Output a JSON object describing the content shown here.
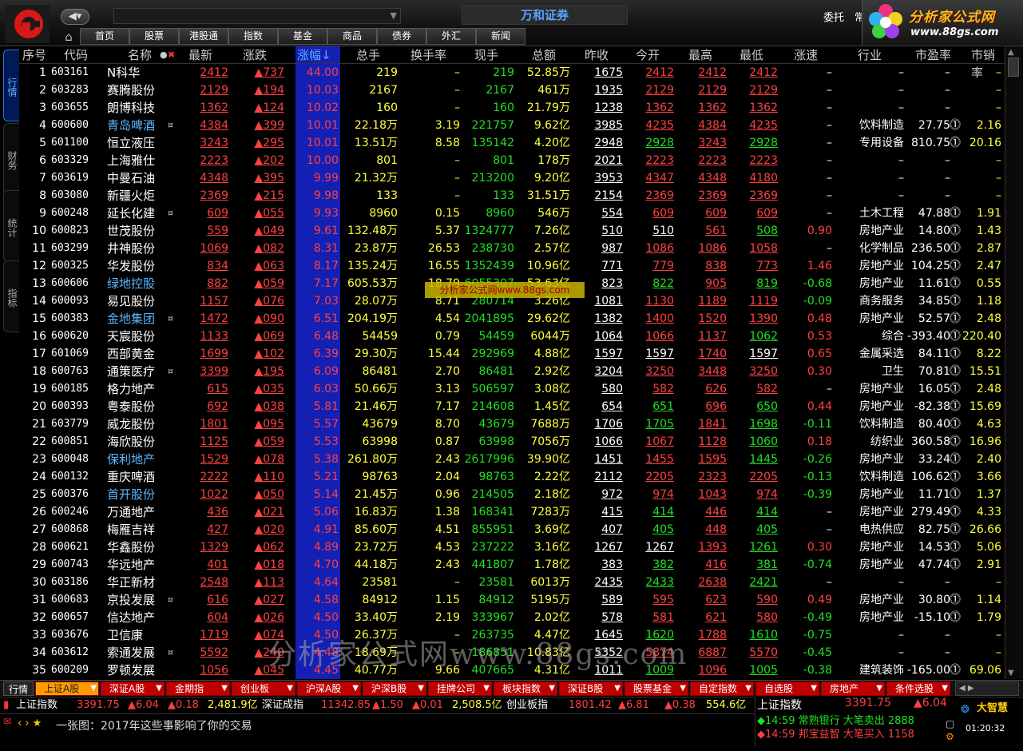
{
  "app_title": "万和证券",
  "top_right": {
    "weituo": "委托",
    "chang": "常"
  },
  "ad": {
    "text": "分析家公式网",
    "url": "www.88gs.com"
  },
  "menu": [
    "首页",
    "股票",
    "港股通",
    "指数",
    "基金",
    "商品",
    "债券",
    "外汇",
    "新闻"
  ],
  "left_tabs": [
    "行情",
    "财务",
    "统计",
    "指标"
  ],
  "headers": [
    "序号",
    "代码",
    "名称",
    "最新",
    "涨跌",
    "涨幅↓",
    "总手",
    "换手率",
    "现手",
    "总额",
    "昨收",
    "今开",
    "最高",
    "最低",
    "涨速",
    "行业",
    "市盈率",
    "市销率"
  ],
  "rows": [
    {
      "seq": "1",
      "code": "603161",
      "name": "N科华",
      "mark": "",
      "last": "2412",
      "chg": "▲737",
      "pct": "44.00",
      "vol": "219",
      "turn": "–",
      "cur": "219",
      "amt": "52.85万",
      "prev": "1675",
      "open": "2412",
      "high": "2412",
      "low": "2412",
      "speed": "–",
      "ind": "–",
      "pe": "–",
      "ps": "–",
      "blue": false,
      "openC": "red",
      "highC": "red",
      "lowC": "red",
      "speedC": "white"
    },
    {
      "seq": "2",
      "code": "603283",
      "name": "赛腾股份",
      "mark": "",
      "last": "2129",
      "chg": "▲194",
      "pct": "10.03",
      "vol": "2167",
      "turn": "–",
      "cur": "2167",
      "amt": "461万",
      "prev": "1935",
      "open": "2129",
      "high": "2129",
      "low": "2129",
      "speed": "–",
      "ind": "–",
      "pe": "–",
      "ps": "–",
      "blue": false,
      "openC": "red",
      "highC": "red",
      "lowC": "red",
      "speedC": "white"
    },
    {
      "seq": "3",
      "code": "603655",
      "name": "朗博科技",
      "mark": "",
      "last": "1362",
      "chg": "▲124",
      "pct": "10.02",
      "vol": "160",
      "turn": "–",
      "cur": "160",
      "amt": "21.79万",
      "prev": "1238",
      "open": "1362",
      "high": "1362",
      "low": "1362",
      "speed": "–",
      "ind": "–",
      "pe": "–",
      "ps": "–",
      "blue": false,
      "openC": "red",
      "highC": "red",
      "lowC": "red",
      "speedC": "white"
    },
    {
      "seq": "4",
      "code": "600600",
      "name": "青岛啤酒",
      "mark": "¤",
      "last": "4384",
      "chg": "▲399",
      "pct": "10.01",
      "vol": "22.18万",
      "turn": "3.19",
      "cur": "221757",
      "amt": "9.62亿",
      "prev": "3985",
      "open": "4235",
      "high": "4384",
      "low": "4235",
      "speed": "–",
      "ind": "饮料制造",
      "pe": "27.75",
      "ps": "2.16",
      "blue": true,
      "openC": "red",
      "highC": "red",
      "lowC": "red",
      "speedC": "white"
    },
    {
      "seq": "5",
      "code": "601100",
      "name": "恒立液压",
      "mark": "",
      "last": "3243",
      "chg": "▲295",
      "pct": "10.01",
      "vol": "13.51万",
      "turn": "8.58",
      "cur": "135142",
      "amt": "4.20亿",
      "prev": "2948",
      "open": "2928",
      "high": "3243",
      "low": "2928",
      "speed": "–",
      "ind": "专用设备",
      "pe": "810.75",
      "ps": "20.16",
      "blue": false,
      "openC": "green",
      "highC": "red",
      "lowC": "green",
      "speedC": "white"
    },
    {
      "seq": "6",
      "code": "603329",
      "name": "上海雅仕",
      "mark": "",
      "last": "2223",
      "chg": "▲202",
      "pct": "10.00",
      "vol": "801",
      "turn": "–",
      "cur": "801",
      "amt": "178万",
      "prev": "2021",
      "open": "2223",
      "high": "2223",
      "low": "2223",
      "speed": "–",
      "ind": "–",
      "pe": "–",
      "ps": "–",
      "blue": false,
      "openC": "red",
      "highC": "red",
      "lowC": "red",
      "speedC": "white"
    },
    {
      "seq": "7",
      "code": "603619",
      "name": "中曼石油",
      "mark": "",
      "last": "4348",
      "chg": "▲395",
      "pct": "9.99",
      "vol": "21.32万",
      "turn": "–",
      "cur": "213200",
      "amt": "9.20亿",
      "prev": "3953",
      "open": "4347",
      "high": "4348",
      "low": "4180",
      "speed": "–",
      "ind": "–",
      "pe": "–",
      "ps": "–",
      "blue": false,
      "openC": "red",
      "highC": "red",
      "lowC": "red",
      "speedC": "white"
    },
    {
      "seq": "8",
      "code": "603080",
      "name": "新疆火炬",
      "mark": "",
      "last": "2369",
      "chg": "▲215",
      "pct": "9.98",
      "vol": "133",
      "turn": "–",
      "cur": "133",
      "amt": "31.51万",
      "prev": "2154",
      "open": "2369",
      "high": "2369",
      "low": "2369",
      "speed": "–",
      "ind": "–",
      "pe": "–",
      "ps": "–",
      "blue": false,
      "openC": "red",
      "highC": "red",
      "lowC": "red",
      "speedC": "white"
    },
    {
      "seq": "9",
      "code": "600248",
      "name": "延长化建",
      "mark": "¤",
      "last": "609",
      "chg": "▲055",
      "pct": "9.93",
      "vol": "8960",
      "turn": "0.15",
      "cur": "8960",
      "amt": "546万",
      "prev": "554",
      "open": "609",
      "high": "609",
      "low": "609",
      "speed": "–",
      "ind": "土木工程",
      "pe": "47.88",
      "ps": "1.91",
      "blue": false,
      "openC": "red",
      "highC": "red",
      "lowC": "red",
      "speedC": "white"
    },
    {
      "seq": "10",
      "code": "600823",
      "name": "世茂股份",
      "mark": "",
      "last": "559",
      "chg": "▲049",
      "pct": "9.61",
      "vol": "132.48万",
      "turn": "5.37",
      "cur": "1324777",
      "amt": "7.26亿",
      "prev": "510",
      "open": "510",
      "high": "561",
      "low": "508",
      "speed": "0.90",
      "ind": "房地产业",
      "pe": "14.80",
      "ps": "1.43",
      "blue": false,
      "openC": "white",
      "highC": "red",
      "lowC": "green",
      "speedC": "red"
    },
    {
      "seq": "11",
      "code": "603299",
      "name": "井神股份",
      "mark": "",
      "last": "1069",
      "chg": "▲082",
      "pct": "8.31",
      "vol": "23.87万",
      "turn": "26.53",
      "cur": "238730",
      "amt": "2.57亿",
      "prev": "987",
      "open": "1086",
      "high": "1086",
      "low": "1058",
      "speed": "–",
      "ind": "化学制品",
      "pe": "236.50",
      "ps": "2.87",
      "blue": false,
      "openC": "red",
      "highC": "red",
      "lowC": "red",
      "speedC": "white"
    },
    {
      "seq": "12",
      "code": "600325",
      "name": "华发股份",
      "mark": "",
      "last": "834",
      "chg": "▲063",
      "pct": "8.17",
      "vol": "135.24万",
      "turn": "16.55",
      "cur": "1352439",
      "amt": "10.96亿",
      "prev": "771",
      "open": "779",
      "high": "838",
      "low": "773",
      "speed": "1.46",
      "ind": "房地产业",
      "pe": "104.25",
      "ps": "2.47",
      "blue": false,
      "openC": "red",
      "highC": "red",
      "lowC": "red",
      "speedC": "red"
    },
    {
      "seq": "13",
      "code": "600606",
      "name": "绿地控股",
      "mark": "",
      "last": "882",
      "chg": "▲059",
      "pct": "7.17",
      "vol": "605.53万",
      "turn": "18.79",
      "cur": "6055307",
      "amt": "53.63亿",
      "prev": "823",
      "open": "822",
      "high": "905",
      "low": "819",
      "speed": "-0.68",
      "ind": "房地产业",
      "pe": "11.61",
      "ps": "0.55",
      "blue": true,
      "openC": "green",
      "highC": "red",
      "lowC": "green",
      "speedC": "green"
    },
    {
      "seq": "14",
      "code": "600093",
      "name": "易见股份",
      "mark": "",
      "last": "1157",
      "chg": "▲076",
      "pct": "7.03",
      "vol": "28.07万",
      "turn": "8.71",
      "cur": "280714",
      "amt": "3.26亿",
      "prev": "1081",
      "open": "1130",
      "high": "1189",
      "low": "1119",
      "speed": "-0.09",
      "ind": "商务服务",
      "pe": "34.85",
      "ps": "1.18",
      "blue": false,
      "openC": "red",
      "highC": "red",
      "lowC": "red",
      "speedC": "green"
    },
    {
      "seq": "15",
      "code": "600383",
      "name": "金地集团",
      "mark": "¤",
      "last": "1472",
      "chg": "▲090",
      "pct": "6.51",
      "vol": "204.19万",
      "turn": "4.54",
      "cur": "2041895",
      "amt": "29.62亿",
      "prev": "1382",
      "open": "1400",
      "high": "1520",
      "low": "1390",
      "speed": "0.48",
      "ind": "房地产业",
      "pe": "52.57",
      "ps": "2.48",
      "blue": true,
      "openC": "red",
      "highC": "red",
      "lowC": "red",
      "speedC": "red"
    },
    {
      "seq": "16",
      "code": "600620",
      "name": "天宸股份",
      "mark": "",
      "last": "1133",
      "chg": "▲069",
      "pct": "6.48",
      "vol": "54459",
      "turn": "0.79",
      "cur": "54459",
      "amt": "6044万",
      "prev": "1064",
      "open": "1066",
      "high": "1137",
      "low": "1062",
      "speed": "0.53",
      "ind": "综合",
      "pe": "-393.40",
      "ps": "220.40",
      "blue": false,
      "openC": "red",
      "highC": "red",
      "lowC": "green",
      "speedC": "red"
    },
    {
      "seq": "17",
      "code": "601069",
      "name": "西部黄金",
      "mark": "",
      "last": "1699",
      "chg": "▲102",
      "pct": "6.39",
      "vol": "29.30万",
      "turn": "15.44",
      "cur": "292969",
      "amt": "4.88亿",
      "prev": "1597",
      "open": "1597",
      "high": "1740",
      "low": "1597",
      "speed": "0.65",
      "ind": "金属采选",
      "pe": "84.11",
      "ps": "8.22",
      "blue": false,
      "openC": "white",
      "highC": "red",
      "lowC": "white",
      "speedC": "red"
    },
    {
      "seq": "18",
      "code": "600763",
      "name": "通策医疗",
      "mark": "¤",
      "last": "3399",
      "chg": "▲195",
      "pct": "6.09",
      "vol": "86481",
      "turn": "2.70",
      "cur": "86481",
      "amt": "2.92亿",
      "prev": "3204",
      "open": "3250",
      "high": "3448",
      "low": "3250",
      "speed": "0.30",
      "ind": "卫生",
      "pe": "70.81",
      "ps": "15.51",
      "blue": false,
      "openC": "red",
      "highC": "red",
      "lowC": "red",
      "speedC": "red"
    },
    {
      "seq": "19",
      "code": "600185",
      "name": "格力地产",
      "mark": "",
      "last": "615",
      "chg": "▲035",
      "pct": "6.03",
      "vol": "50.66万",
      "turn": "3.13",
      "cur": "506597",
      "amt": "3.08亿",
      "prev": "580",
      "open": "582",
      "high": "626",
      "low": "582",
      "speed": "–",
      "ind": "房地产业",
      "pe": "16.05",
      "ps": "2.48",
      "blue": false,
      "openC": "red",
      "highC": "red",
      "lowC": "red",
      "speedC": "white"
    },
    {
      "seq": "20",
      "code": "600393",
      "name": "粤泰股份",
      "mark": "",
      "last": "692",
      "chg": "▲038",
      "pct": "5.81",
      "vol": "21.46万",
      "turn": "7.17",
      "cur": "214608",
      "amt": "1.45亿",
      "prev": "654",
      "open": "651",
      "high": "696",
      "low": "650",
      "speed": "0.44",
      "ind": "房地产业",
      "pe": "-82.38",
      "ps": "15.69",
      "blue": false,
      "openC": "green",
      "highC": "red",
      "lowC": "green",
      "speedC": "red"
    },
    {
      "seq": "21",
      "code": "603779",
      "name": "威龙股份",
      "mark": "",
      "last": "1801",
      "chg": "▲095",
      "pct": "5.57",
      "vol": "43679",
      "turn": "8.70",
      "cur": "43679",
      "amt": "7688万",
      "prev": "1706",
      "open": "1705",
      "high": "1841",
      "low": "1698",
      "speed": "-0.11",
      "ind": "饮料制造",
      "pe": "80.40",
      "ps": "4.63",
      "blue": false,
      "openC": "green",
      "highC": "red",
      "lowC": "green",
      "speedC": "green"
    },
    {
      "seq": "22",
      "code": "600851",
      "name": "海欣股份",
      "mark": "",
      "last": "1125",
      "chg": "▲059",
      "pct": "5.53",
      "vol": "63998",
      "turn": "0.87",
      "cur": "63998",
      "amt": "7056万",
      "prev": "1066",
      "open": "1067",
      "high": "1128",
      "low": "1060",
      "speed": "0.18",
      "ind": "纺织业",
      "pe": "360.58",
      "ps": "16.96",
      "blue": false,
      "openC": "red",
      "highC": "red",
      "lowC": "green",
      "speedC": "red"
    },
    {
      "seq": "23",
      "code": "600048",
      "name": "保利地产",
      "mark": "",
      "last": "1529",
      "chg": "▲078",
      "pct": "5.38",
      "vol": "261.80万",
      "turn": "2.43",
      "cur": "2617996",
      "amt": "39.90亿",
      "prev": "1451",
      "open": "1455",
      "high": "1595",
      "low": "1445",
      "speed": "-0.26",
      "ind": "房地产业",
      "pe": "33.24",
      "ps": "2.40",
      "blue": true,
      "openC": "red",
      "highC": "red",
      "lowC": "green",
      "speedC": "green"
    },
    {
      "seq": "24",
      "code": "600132",
      "name": "重庆啤酒",
      "mark": "",
      "last": "2222",
      "chg": "▲110",
      "pct": "5.21",
      "vol": "98763",
      "turn": "2.04",
      "cur": "98763",
      "amt": "2.22亿",
      "prev": "2112",
      "open": "2205",
      "high": "2323",
      "low": "2205",
      "speed": "-0.13",
      "ind": "饮料制造",
      "pe": "106.62",
      "ps": "3.66",
      "blue": false,
      "openC": "red",
      "highC": "red",
      "lowC": "red",
      "speedC": "green"
    },
    {
      "seq": "25",
      "code": "600376",
      "name": "首开股份",
      "mark": "",
      "last": "1022",
      "chg": "▲050",
      "pct": "5.14",
      "vol": "21.45万",
      "turn": "0.96",
      "cur": "214505",
      "amt": "2.18亿",
      "prev": "972",
      "open": "974",
      "high": "1043",
      "low": "974",
      "speed": "-0.39",
      "ind": "房地产业",
      "pe": "11.71",
      "ps": "1.37",
      "blue": true,
      "openC": "red",
      "highC": "red",
      "lowC": "red",
      "speedC": "green"
    },
    {
      "seq": "26",
      "code": "600246",
      "name": "万通地产",
      "mark": "",
      "last": "436",
      "chg": "▲021",
      "pct": "5.06",
      "vol": "16.83万",
      "turn": "1.38",
      "cur": "168341",
      "amt": "7283万",
      "prev": "415",
      "open": "414",
      "high": "446",
      "low": "414",
      "speed": "–",
      "ind": "房地产业",
      "pe": "279.49",
      "ps": "4.33",
      "blue": false,
      "openC": "green",
      "highC": "red",
      "lowC": "green",
      "speedC": "white"
    },
    {
      "seq": "27",
      "code": "600868",
      "name": "梅雁吉祥",
      "mark": "",
      "last": "427",
      "chg": "▲020",
      "pct": "4.91",
      "vol": "85.60万",
      "turn": "4.51",
      "cur": "855951",
      "amt": "3.69亿",
      "prev": "407",
      "open": "405",
      "high": "448",
      "low": "405",
      "speed": "–",
      "ind": "电热供应",
      "pe": "82.75",
      "ps": "26.66",
      "blue": false,
      "openC": "green",
      "highC": "red",
      "lowC": "green",
      "speedC": "white"
    },
    {
      "seq": "28",
      "code": "600621",
      "name": "华鑫股份",
      "mark": "",
      "last": "1329",
      "chg": "▲062",
      "pct": "4.89",
      "vol": "23.72万",
      "turn": "4.53",
      "cur": "237222",
      "amt": "3.16亿",
      "prev": "1267",
      "open": "1267",
      "high": "1393",
      "low": "1261",
      "speed": "0.30",
      "ind": "房地产业",
      "pe": "14.53",
      "ps": "5.06",
      "blue": false,
      "openC": "white",
      "highC": "red",
      "lowC": "green",
      "speedC": "red"
    },
    {
      "seq": "29",
      "code": "600743",
      "name": "华远地产",
      "mark": "",
      "last": "401",
      "chg": "▲018",
      "pct": "4.70",
      "vol": "44.18万",
      "turn": "2.43",
      "cur": "441807",
      "amt": "1.78亿",
      "prev": "383",
      "open": "382",
      "high": "416",
      "low": "381",
      "speed": "-0.74",
      "ind": "房地产业",
      "pe": "47.74",
      "ps": "2.91",
      "blue": false,
      "openC": "green",
      "highC": "red",
      "lowC": "green",
      "speedC": "green"
    },
    {
      "seq": "30",
      "code": "603186",
      "name": "华正新材",
      "mark": "",
      "last": "2548",
      "chg": "▲113",
      "pct": "4.64",
      "vol": "23581",
      "turn": "–",
      "cur": "23581",
      "amt": "6013万",
      "prev": "2435",
      "open": "2433",
      "high": "2638",
      "low": "2421",
      "speed": "–",
      "ind": "–",
      "pe": "–",
      "ps": "–",
      "blue": false,
      "openC": "green",
      "highC": "red",
      "lowC": "green",
      "speedC": "white"
    },
    {
      "seq": "31",
      "code": "600683",
      "name": "京投发展",
      "mark": "¤",
      "last": "616",
      "chg": "▲027",
      "pct": "4.58",
      "vol": "84912",
      "turn": "1.15",
      "cur": "84912",
      "amt": "5195万",
      "prev": "589",
      "open": "595",
      "high": "623",
      "low": "590",
      "speed": "0.49",
      "ind": "房地产业",
      "pe": "30.80",
      "ps": "1.14",
      "blue": false,
      "openC": "red",
      "highC": "red",
      "lowC": "red",
      "speedC": "red"
    },
    {
      "seq": "32",
      "code": "600657",
      "name": "信达地产",
      "mark": "",
      "last": "604",
      "chg": "▲026",
      "pct": "4.50",
      "vol": "33.40万",
      "turn": "2.19",
      "cur": "333967",
      "amt": "2.02亿",
      "prev": "578",
      "open": "581",
      "high": "621",
      "low": "580",
      "speed": "-0.49",
      "ind": "房地产业",
      "pe": "-15.10",
      "ps": "1.79",
      "blue": false,
      "openC": "red",
      "highC": "red",
      "lowC": "red",
      "speedC": "green"
    },
    {
      "seq": "33",
      "code": "603676",
      "name": "卫信康",
      "mark": "",
      "last": "1719",
      "chg": "▲074",
      "pct": "4.50",
      "vol": "26.37万",
      "turn": "–",
      "cur": "263735",
      "amt": "4.47亿",
      "prev": "1645",
      "open": "1620",
      "high": "1788",
      "low": "1610",
      "speed": "-0.75",
      "ind": "–",
      "pe": "–",
      "ps": "–",
      "blue": false,
      "openC": "green",
      "highC": "red",
      "lowC": "green",
      "speedC": "green"
    },
    {
      "seq": "34",
      "code": "603612",
      "name": "索通发展",
      "mark": "¤",
      "last": "5592",
      "chg": "▲240",
      "pct": "4.48",
      "vol": "18.69万",
      "turn": "–",
      "cur": "186851",
      "amt": "10.83亿",
      "prev": "5352",
      "open": "5874",
      "high": "6887",
      "low": "5570",
      "speed": "-0.45",
      "ind": "–",
      "pe": "–",
      "ps": "–",
      "blue": false,
      "openC": "red",
      "highC": "red",
      "lowC": "red",
      "speedC": "green"
    },
    {
      "seq": "35",
      "code": "600209",
      "name": "罗顿发展",
      "mark": "",
      "last": "1056",
      "chg": "▲045",
      "pct": "4.45",
      "vol": "40.77万",
      "turn": "9.66",
      "cur": "407665",
      "amt": "4.31亿",
      "prev": "1011",
      "open": "1009",
      "high": "1096",
      "low": "1005",
      "speed": "-0.38",
      "ind": "建筑装饰",
      "pe": "-165.00",
      "ps": "69.06",
      "blue": false,
      "openC": "green",
      "highC": "red",
      "lowC": "green",
      "speedC": "green"
    }
  ],
  "bottom_tabs": [
    "上证A股",
    "深证A股",
    "金期指",
    "创业板",
    "沪深A股",
    "沪深B股",
    "挂牌公司",
    "板块指数",
    "深证B股",
    "股票基金",
    "自定指数",
    "自选股",
    "房地产",
    "条件选股"
  ],
  "bottom_left_label": "行情",
  "ticker": {
    "sh_name": "上证指数",
    "sh_val": "3391.75",
    "sh_chg": "▲6.04",
    "sh_pct": "▲0.18",
    "sh_amt": "2,481.9亿",
    "sz_name": "深证成指",
    "sz_val": "11342.85",
    "sz_chg": "▲1.50",
    "sz_pct": "▲0.01",
    "sz_amt": "2,508.5亿",
    "cy_name": "创业板指",
    "cy_val": "1801.42",
    "cy_chg": "▲6.81",
    "cy_pct": "▲0.38",
    "cy_amt": "554.6亿"
  },
  "right_panel": {
    "idx_name": "上证指数",
    "idx_val": "3391.75",
    "idx_chg": "▲6.04",
    "line1": "◆14:59 常熟银行 大笔卖出 2888",
    "line2": "◆14:59 邦宝益智 大笔买入 1158"
  },
  "news_line": "一张图：2017年这些事影响了你的交易",
  "brand": "大智慧",
  "clock": "01:20:32",
  "watermarks": {
    "mid": "分析家公式网www.88gs.com",
    "big": "分析家公式网www.88gs.com"
  }
}
